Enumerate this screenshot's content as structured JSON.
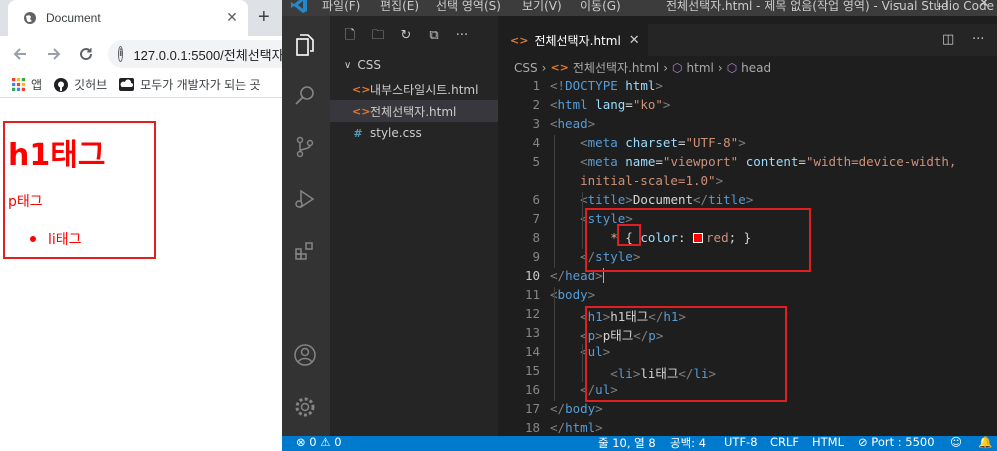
{
  "browser": {
    "tab_title": "Document",
    "tab_close": "✕",
    "new_tab": "+",
    "url": "127.0.0.1:5500/전체선택자.html",
    "bookmarks": [
      {
        "label": "앱",
        "icon": "apps-grid-icon"
      },
      {
        "label": "깃허브",
        "icon": "github-icon"
      },
      {
        "label": "모두가 개발자가 되는 곳",
        "icon": "cloud-icon"
      }
    ],
    "page": {
      "h1": "h1태그",
      "p": "p태그",
      "li": "li태그",
      "text_color": "#ff0000"
    }
  },
  "vscode": {
    "menu": [
      "파일(F)",
      "편집(E)",
      "선택 영역(S)",
      "보기(V)",
      "이동(G)"
    ],
    "window_title": "전체선택자.html - 제목 없음(작업 영역) - Visual Studio Code",
    "explorer": {
      "folder": "CSS",
      "files": [
        {
          "name": "내부스타일시트.html",
          "icon": "<>",
          "active": false
        },
        {
          "name": "전체선택자.html",
          "icon": "<>",
          "active": true
        },
        {
          "name": "style.css",
          "icon": "#",
          "active": false
        }
      ]
    },
    "editor_tab": "전체선택자.html",
    "breadcrumb": [
      "CSS",
      "전체선택자.html",
      "html",
      "head"
    ],
    "code_lines": [
      {
        "n": "1",
        "tokens": [
          [
            "br",
            "<!"
          ],
          [
            "tg",
            "DOCTYPE"
          ],
          [
            "tx",
            " "
          ],
          [
            "at",
            "html"
          ],
          [
            "br",
            ">"
          ]
        ]
      },
      {
        "n": "2",
        "tokens": [
          [
            "br",
            "<"
          ],
          [
            "tg",
            "html"
          ],
          [
            "tx",
            " "
          ],
          [
            "at",
            "lang"
          ],
          [
            "tx",
            "="
          ],
          [
            "st",
            "\"ko\""
          ],
          [
            "br",
            ">"
          ]
        ]
      },
      {
        "n": "3",
        "tokens": [
          [
            "br",
            "<"
          ],
          [
            "tg",
            "head"
          ],
          [
            "br",
            ">"
          ]
        ]
      },
      {
        "n": "4",
        "tokens": [
          [
            "tx",
            "    "
          ],
          [
            "br",
            "<"
          ],
          [
            "tg",
            "meta"
          ],
          [
            "tx",
            " "
          ],
          [
            "at",
            "charset"
          ],
          [
            "tx",
            "="
          ],
          [
            "st",
            "\"UTF-8\""
          ],
          [
            "br",
            ">"
          ]
        ]
      },
      {
        "n": "5",
        "tokens": [
          [
            "tx",
            "    "
          ],
          [
            "br",
            "<"
          ],
          [
            "tg",
            "meta"
          ],
          [
            "tx",
            " "
          ],
          [
            "at",
            "name"
          ],
          [
            "tx",
            "="
          ],
          [
            "st",
            "\"viewport\""
          ],
          [
            "tx",
            " "
          ],
          [
            "at",
            "content"
          ],
          [
            "tx",
            "="
          ],
          [
            "st",
            "\"width=device-width,"
          ]
        ]
      },
      {
        "n": "",
        "tokens": [
          [
            "st",
            "    initial-scale=1.0\""
          ],
          [
            "br",
            ">"
          ]
        ]
      },
      {
        "n": "6",
        "tokens": [
          [
            "tx",
            "    "
          ],
          [
            "br",
            "<"
          ],
          [
            "tg",
            "title"
          ],
          [
            "br",
            ">"
          ],
          [
            "tx",
            "Document"
          ],
          [
            "br",
            "</"
          ],
          [
            "tg",
            "title"
          ],
          [
            "br",
            ">"
          ]
        ]
      },
      {
        "n": "7",
        "tokens": [
          [
            "tx",
            "    "
          ],
          [
            "br",
            "<"
          ],
          [
            "tg",
            "style"
          ],
          [
            "br",
            ">"
          ]
        ]
      },
      {
        "n": "8",
        "tokens": [
          [
            "tx",
            "        "
          ],
          [
            "sel",
            "*"
          ],
          [
            "tx",
            " { "
          ],
          [
            "at",
            "color"
          ],
          [
            "tx",
            ": "
          ],
          [
            "swatch",
            ""
          ],
          [
            "st",
            "red"
          ],
          [
            "tx",
            "; }"
          ]
        ]
      },
      {
        "n": "9",
        "tokens": [
          [
            "tx",
            "    "
          ],
          [
            "br",
            "</"
          ],
          [
            "tg",
            "style"
          ],
          [
            "br",
            ">"
          ]
        ]
      },
      {
        "n": "10",
        "tokens": [
          [
            "br",
            "</"
          ],
          [
            "tg",
            "head"
          ],
          [
            "br",
            ">"
          ],
          [
            "caret",
            ""
          ]
        ]
      },
      {
        "n": "11",
        "tokens": [
          [
            "br",
            "<"
          ],
          [
            "tg",
            "body"
          ],
          [
            "br",
            ">"
          ]
        ]
      },
      {
        "n": "12",
        "tokens": [
          [
            "tx",
            "    "
          ],
          [
            "br",
            "<"
          ],
          [
            "tg",
            "h1"
          ],
          [
            "br",
            ">"
          ],
          [
            "tx",
            "h1태그"
          ],
          [
            "br",
            "</"
          ],
          [
            "tg",
            "h1"
          ],
          [
            "br",
            ">"
          ]
        ]
      },
      {
        "n": "13",
        "tokens": [
          [
            "tx",
            "    "
          ],
          [
            "br",
            "<"
          ],
          [
            "tg",
            "p"
          ],
          [
            "br",
            ">"
          ],
          [
            "tx",
            "p태그"
          ],
          [
            "br",
            "</"
          ],
          [
            "tg",
            "p"
          ],
          [
            "br",
            ">"
          ]
        ]
      },
      {
        "n": "14",
        "tokens": [
          [
            "tx",
            "    "
          ],
          [
            "br",
            "<"
          ],
          [
            "tg",
            "ul"
          ],
          [
            "br",
            ">"
          ]
        ]
      },
      {
        "n": "15",
        "tokens": [
          [
            "tx",
            "        "
          ],
          [
            "br",
            "<"
          ],
          [
            "tg",
            "li"
          ],
          [
            "br",
            ">"
          ],
          [
            "tx",
            "li태그"
          ],
          [
            "br",
            "</"
          ],
          [
            "tg",
            "li"
          ],
          [
            "br",
            ">"
          ]
        ]
      },
      {
        "n": "16",
        "tokens": [
          [
            "tx",
            "    "
          ],
          [
            "br",
            "</"
          ],
          [
            "tg",
            "ul"
          ],
          [
            "br",
            ">"
          ]
        ]
      },
      {
        "n": "17",
        "tokens": [
          [
            "br",
            "</"
          ],
          [
            "tg",
            "body"
          ],
          [
            "br",
            ">"
          ]
        ]
      },
      {
        "n": "18",
        "tokens": [
          [
            "br",
            "</"
          ],
          [
            "tg",
            "html"
          ],
          [
            "br",
            ">"
          ]
        ]
      }
    ],
    "status": {
      "problems": "⊗ 0 ⚠ 0",
      "position": "줄 10, 열 8",
      "indent": "공백: 4",
      "encoding": "UTF-8",
      "eol": "CRLF",
      "language": "HTML",
      "port": "⊘ Port : 5500"
    }
  },
  "colors": {
    "highlight_box": "#e02020",
    "statusbar": "#007acc",
    "editor_bg": "#1e1e1e"
  }
}
